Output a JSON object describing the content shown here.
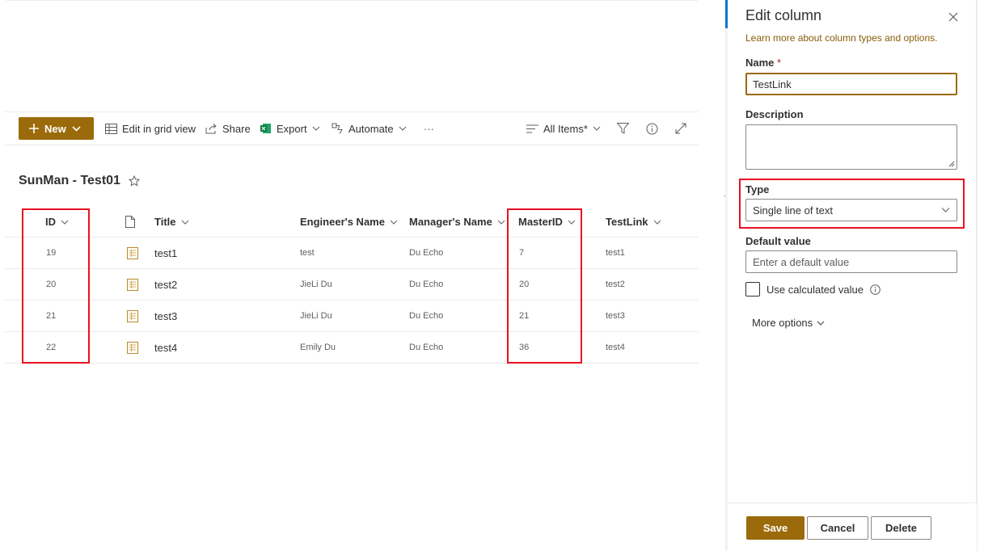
{
  "commandbar": {
    "new_label": "New",
    "edit_grid_label": "Edit in grid view",
    "share_label": "Share",
    "export_label": "Export",
    "automate_label": "Automate",
    "more_label": "···",
    "view_label": "All Items*"
  },
  "list": {
    "title": "SunMan - Test01",
    "columns": {
      "id": "ID",
      "title": "Title",
      "engineer": "Engineer's Name",
      "manager": "Manager's Name",
      "masterid": "MasterID",
      "testlink": "TestLink"
    },
    "rows": [
      {
        "id": "19",
        "title": "test1",
        "engineer": "test",
        "manager": "Du Echo",
        "masterid": "7",
        "testlink": "test1"
      },
      {
        "id": "20",
        "title": "test2",
        "engineer": "JieLi Du",
        "manager": "Du Echo",
        "masterid": "20",
        "testlink": "test2"
      },
      {
        "id": "21",
        "title": "test3",
        "engineer": "JieLi Du",
        "manager": "Du Echo",
        "masterid": "21",
        "testlink": "test3"
      },
      {
        "id": "22",
        "title": "test4",
        "engineer": "Emily Du",
        "manager": "Du Echo",
        "masterid": "36",
        "testlink": "test4"
      }
    ]
  },
  "panel": {
    "title": "Edit column",
    "learn_more": "Learn more about column types and options.",
    "name_label": "Name",
    "name_required": "*",
    "name_value": "TestLink",
    "description_label": "Description",
    "description_value": "",
    "type_label": "Type",
    "type_value": "Single line of text",
    "default_label": "Default value",
    "default_placeholder": "Enter a default value",
    "calc_label": "Use calculated value",
    "more_options": "More options",
    "save": "Save",
    "cancel": "Cancel",
    "delete": "Delete"
  },
  "colors": {
    "accent": "#9b6b0b",
    "highlight": "#e81123",
    "link": "#8a5e0a"
  }
}
